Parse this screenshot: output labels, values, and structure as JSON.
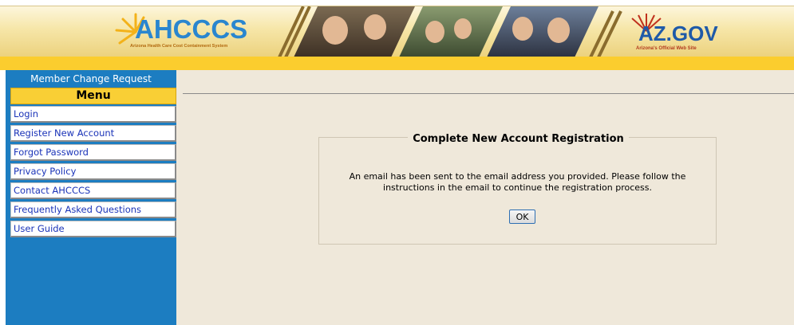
{
  "header": {
    "logo_text": "AHCCCS",
    "logo_subtitle": "Arizona Health Care Cost Containment System",
    "azgov_text": "AZ.GOV",
    "azgov_subtitle": "Arizona's Official Web Site"
  },
  "sidebar": {
    "title": "Member Change Request",
    "menu_heading": "Menu",
    "items": [
      {
        "label": "Login"
      },
      {
        "label": "Register New Account"
      },
      {
        "label": "Forgot Password"
      },
      {
        "label": "Privacy Policy"
      },
      {
        "label": "Contact AHCCCS"
      },
      {
        "label": "Frequently Asked Questions"
      },
      {
        "label": "User Guide"
      }
    ]
  },
  "main": {
    "panel_title": "Complete New Account Registration",
    "message": "An email has been sent to the email address you provided. Please follow the instructions in the email to continue the registration process.",
    "ok_label": "OK"
  },
  "colors": {
    "sidebar_bg": "#1c7dc1",
    "menu_heading_bg": "#f9cf35",
    "main_bg": "#efe8da",
    "link": "#1a33b8"
  }
}
